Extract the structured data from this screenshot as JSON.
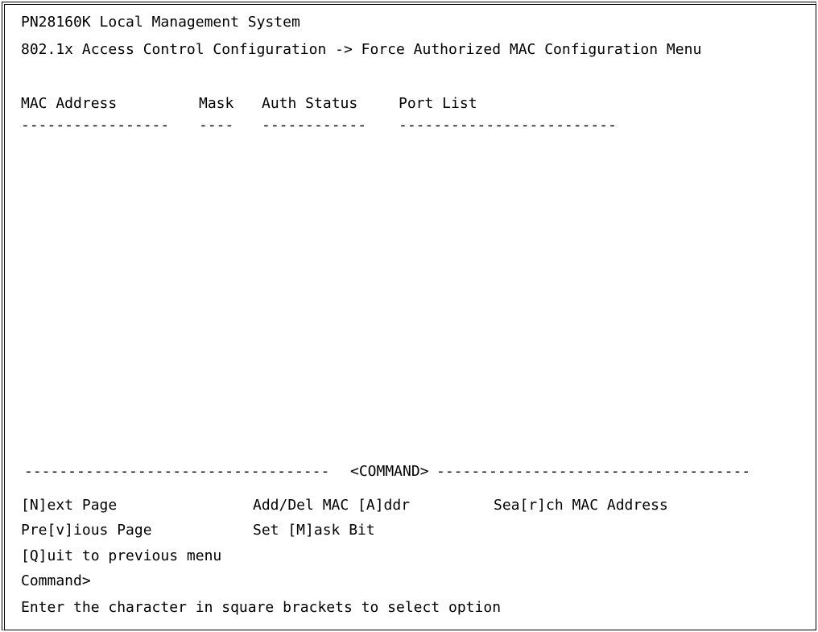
{
  "header": {
    "system_title": "PN28160K Local Management System",
    "menu_path": "802.1x Access Control Configuration -> Force Authorized MAC Configuration Menu"
  },
  "table": {
    "columns": [
      {
        "label": "MAC Address",
        "underline": "-----------------"
      },
      {
        "label": "Mask",
        "underline": "----"
      },
      {
        "label": "Auth Status",
        "underline": "------------"
      },
      {
        "label": "Port List",
        "underline": "-------------------------"
      }
    ],
    "rows": []
  },
  "command_bar": {
    "left_rule": "-----------------------------------",
    "label": "<COMMAND>",
    "right_rule": "------------------------------------"
  },
  "commands": {
    "next_page": "[N]ext Page",
    "add_del_mac": "Add/Del MAC [A]ddr",
    "search_mac": "Sea[r]ch MAC Address",
    "previous_page": "Pre[v]ious Page",
    "set_mask": "Set [M]ask Bit",
    "quit": "[Q]uit to previous menu"
  },
  "prompt": {
    "label": "Command>",
    "value": ""
  },
  "help_text": "Enter the character in square brackets to select option"
}
